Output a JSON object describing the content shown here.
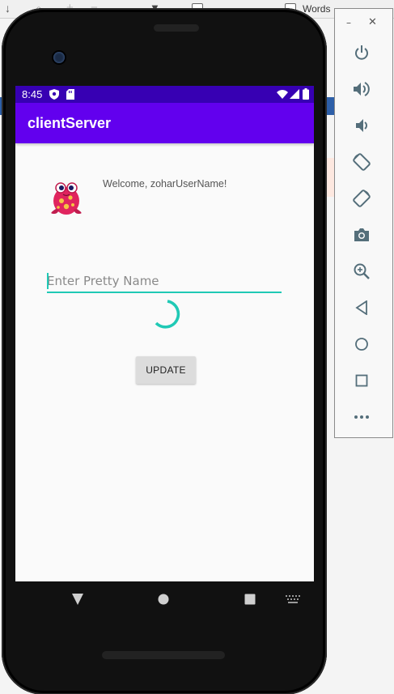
{
  "background_toolbar": {
    "item_words": "Words"
  },
  "status_bar": {
    "time": "8:45"
  },
  "app_bar": {
    "title": "clientServer"
  },
  "main": {
    "welcome_text": "Welcome, zoharUserName!",
    "name_input_placeholder": "Enter Pretty Name",
    "name_input_value": "",
    "update_button_label": "UPDATE"
  },
  "nav_bar": {
    "icons": [
      "back-icon",
      "home-icon",
      "recents-icon",
      "keyboard-icon"
    ]
  },
  "emulator_panel": {
    "buttons": [
      "power-icon",
      "volume-up-icon",
      "volume-down-icon",
      "rotate-left-icon",
      "rotate-right-icon",
      "camera-icon",
      "zoom-icon",
      "back-icon",
      "home-icon",
      "overview-icon",
      "more-icon"
    ]
  },
  "colors": {
    "status_bar": "#3700b3",
    "app_bar": "#6200ee",
    "accent": "#20c9b5"
  }
}
